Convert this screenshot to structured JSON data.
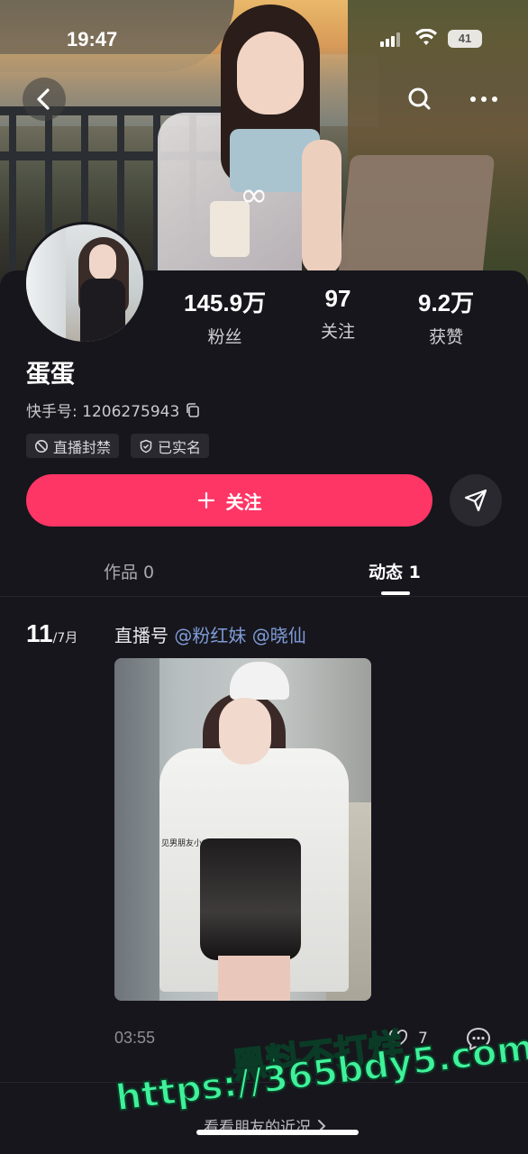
{
  "status_bar": {
    "time": "19:47",
    "battery": "41"
  },
  "cover": {
    "overlay_symbol": "∞"
  },
  "profile": {
    "name": "蛋蛋",
    "kuaishou_id_label": "快手号: 1206275943",
    "stats": [
      {
        "value": "145.9万",
        "label": "粉丝"
      },
      {
        "value": "97",
        "label": "关注"
      },
      {
        "value": "9.2万",
        "label": "获赞"
      }
    ],
    "tags": [
      {
        "icon": "ban-icon",
        "label": "直播封禁"
      },
      {
        "icon": "shield-check-icon",
        "label": "已实名"
      }
    ]
  },
  "actions": {
    "follow_label": "关注",
    "follow_color": "#fe3666"
  },
  "tabs": [
    {
      "label": "作品 0",
      "active": false
    },
    {
      "label": "动态 1",
      "active": true
    }
  ],
  "post": {
    "day": "11",
    "month": "/7月",
    "text_prefix": "直播号",
    "mentions": [
      "@粉红妹",
      "@晓仙"
    ],
    "image_caption": "见男朋友小tips",
    "duration": "03:55",
    "likes": "7"
  },
  "bottom": {
    "friends_link": "看看朋友的近况"
  },
  "watermark": {
    "line1": "黑料不打烊",
    "line2": "https://365bdy5.com",
    "color": "#3ff29a"
  }
}
